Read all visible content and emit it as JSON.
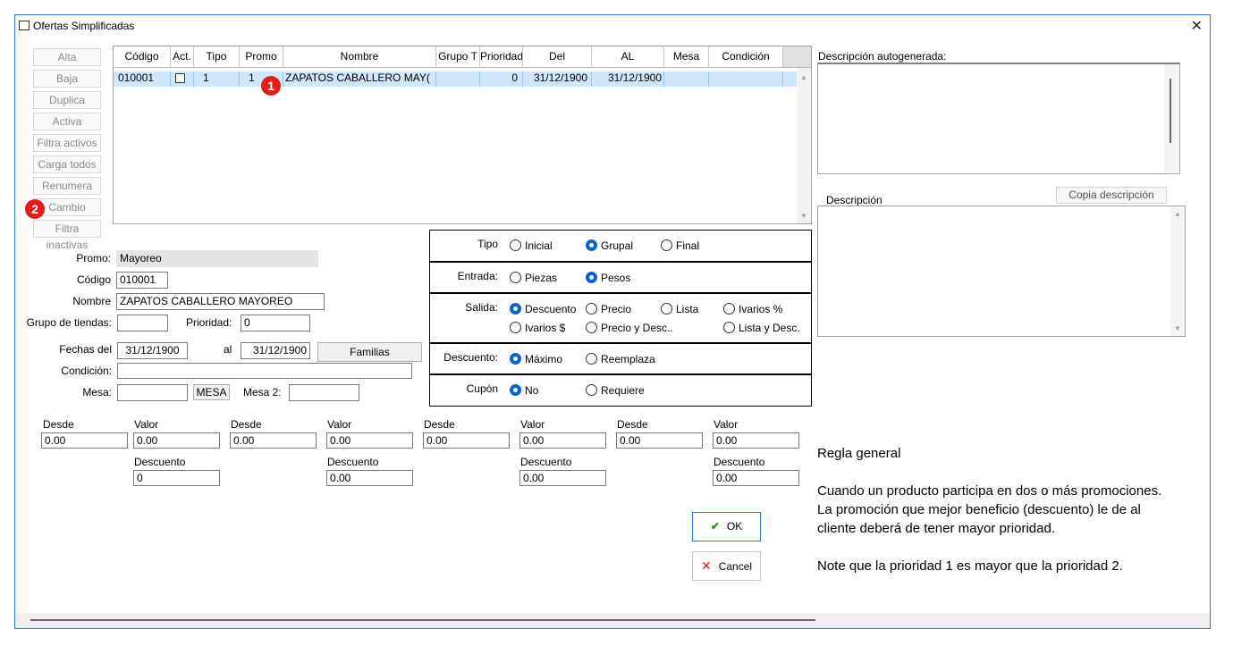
{
  "window": {
    "title": "Ofertas Simplificadas",
    "close": "✕"
  },
  "sidebar": {
    "items": [
      {
        "label": "Alta"
      },
      {
        "label": "Baja"
      },
      {
        "label": "Duplica"
      },
      {
        "label": "Activa"
      },
      {
        "label": "Filtra activos"
      },
      {
        "label": "Carga todos"
      },
      {
        "label": "Renumera"
      },
      {
        "label": "Cambio"
      },
      {
        "label": "Filtra inactivas"
      }
    ]
  },
  "grid": {
    "columns": [
      "Código",
      "Act.",
      "Tipo",
      "Promo",
      "Nombre",
      "Grupo T",
      "Prioridad",
      "Del",
      "AL",
      "Mesa",
      "Condición"
    ],
    "rows": [
      {
        "codigo": "010001",
        "tipo": "1",
        "promo": "1",
        "nombre": "ZAPATOS CABALLERO MAY(",
        "grupo": "",
        "prioridad": "0",
        "del": "31/12/1900",
        "al": "31/12/1900",
        "mesa": "",
        "condicion": ""
      }
    ]
  },
  "badges": {
    "one": "1",
    "two": "2"
  },
  "form": {
    "promo_label": "Promo:",
    "promo_value": "Mayoreo",
    "codigo_label": "Código",
    "codigo_value": "010001",
    "nombre_label": "Nombre",
    "nombre_value": "ZAPATOS CABALLERO MAYOREO",
    "grupo_label": "Grupo de tiendas:",
    "grupo_value": "",
    "prioridad_label": "Prioridad:",
    "prioridad_value": "0",
    "fechas_label": "Fechas del",
    "fecha_del": "31/12/1900",
    "al_label": "al",
    "fecha_al": "31/12/1900",
    "familias_button": "Familias",
    "condicion_label": "Condición:",
    "condicion_value": "",
    "mesa_label": "Mesa:",
    "mesa_value": "",
    "mesa_button": "MESA",
    "mesa2_label": "Mesa 2:",
    "mesa2_value": ""
  },
  "options": {
    "tipo": {
      "label": "Tipo",
      "options": [
        "Inicial",
        "Grupal",
        "Final"
      ],
      "selected": "Grupal"
    },
    "entrada": {
      "label": "Entrada:",
      "options": [
        "Piezas",
        "Pesos"
      ],
      "selected": "Pesos"
    },
    "salida": {
      "label": "Salida:",
      "options": [
        "Descuento",
        "Precio",
        "Lista",
        "Ivarios %",
        "Ivarios $",
        "Precio y Desc..",
        "Lista y Desc."
      ],
      "selected": "Descuento"
    },
    "descuento": {
      "label": "Descuento:",
      "options": [
        "Máximo",
        "Reemplaza"
      ],
      "selected": "Máximo"
    },
    "cupon": {
      "label": "Cupón",
      "options": [
        "No",
        "Requiere"
      ],
      "selected": "No"
    }
  },
  "ranges": {
    "desde_label": "Desde",
    "valor_label": "Valor",
    "descuento_label": "Descuento",
    "groups": [
      {
        "desde": "0.00",
        "valor": "0.00",
        "descuento": "0"
      },
      {
        "desde": "0.00",
        "valor": "0.00",
        "descuento": "0.00"
      },
      {
        "desde": "0.00",
        "valor": "0.00",
        "descuento": "0.00"
      },
      {
        "desde": "0.00",
        "valor": "0.00",
        "descuento": "0.00"
      }
    ]
  },
  "right": {
    "auto_label": "Descripción autogenerada:",
    "desc_label": "Descripción",
    "copy_button": "Copia descripción"
  },
  "rule": {
    "title": "Regla general",
    "line1": "Cuando un producto participa en dos o más  promociones.",
    "line2": "La promoción que mejor beneficio (descuento)  le de al",
    "line3": "cliente deberá de tener mayor prioridad.",
    "note": "Note que la prioridad 1 es mayor que la prioridad 2."
  },
  "actions": {
    "ok": "OK",
    "cancel": "Cancel"
  },
  "colors": {
    "accent": "#0a64c8",
    "badge": "#e51c1c",
    "selection": "#cfe6fb",
    "ok_check": "#2e8b1e",
    "cancel_x": "#d42020"
  }
}
